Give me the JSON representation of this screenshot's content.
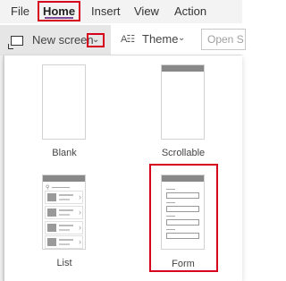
{
  "menubar": {
    "items": [
      {
        "label": "File"
      },
      {
        "label": "Home"
      },
      {
        "label": "Insert"
      },
      {
        "label": "View"
      },
      {
        "label": "Action"
      }
    ],
    "active": "Home"
  },
  "toolbar": {
    "new_screen_label": "New screen",
    "theme_label": "Theme",
    "open_placeholder": "Open S"
  },
  "screen_templates": [
    {
      "label": "Blank"
    },
    {
      "label": "Scrollable"
    },
    {
      "label": "List"
    },
    {
      "label": "Form"
    }
  ],
  "colors": {
    "highlight": "#d6001c",
    "accent_underline": "#7a4b99",
    "toolbar_selected_bg": "#e6e6e6"
  }
}
